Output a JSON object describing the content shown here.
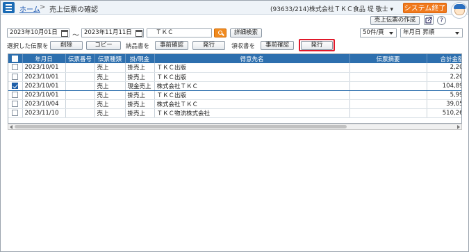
{
  "header": {
    "home_link": "ホーム",
    "separator": ">",
    "current_page": "売上伝票の確認",
    "user_info": "(93633/214)株式会社ＴＫＣ食品  堤  敬士 ▾",
    "exit_button": "システム終了"
  },
  "toolbar": {
    "create_button": "売上伝票の作成",
    "help_glyph": "?"
  },
  "search": {
    "date_from": "2023年10月01日",
    "range_sep": "〜",
    "date_to": "2023年11月11日",
    "keyword": "ＴＫＣ",
    "detail_button": "詳細検索",
    "per_page": "50件/頁",
    "sort": "年月日  昇順"
  },
  "actions": {
    "selected_label": "選択した伝票を",
    "delete_button": "削除",
    "copy_button": "コピー",
    "delivery_label": "納品書を",
    "delivery_preview": "事前確認",
    "delivery_issue": "発行",
    "receipt_label": "領収書を",
    "receipt_preview": "事前確認",
    "receipt_issue": "発行"
  },
  "table": {
    "headers": [
      "",
      "年月日",
      "伝票番号",
      "伝票種類",
      "掛/現金",
      "得意先名",
      "伝票摘要",
      "合計金額"
    ],
    "rows": [
      {
        "checked": false,
        "date": "2023/10/01",
        "no": "",
        "type": "売上",
        "pay": "掛売上",
        "customer": "ＴＫＣ出版",
        "memo": "",
        "total": "2,20"
      },
      {
        "checked": false,
        "date": "2023/10/01",
        "no": "",
        "type": "売上",
        "pay": "掛売上",
        "customer": "ＴＫＣ出版",
        "memo": "",
        "total": "2,20"
      },
      {
        "checked": true,
        "date": "2023/10/01",
        "no": "",
        "type": "売上",
        "pay": "現金売上",
        "customer": "株式会社ＴＫＣ",
        "memo": "",
        "total": "104,89"
      },
      {
        "checked": false,
        "date": "2023/10/01",
        "no": "",
        "type": "売上",
        "pay": "掛売上",
        "customer": "ＴＫＣ出版",
        "memo": "",
        "total": "5,99"
      },
      {
        "checked": false,
        "date": "2023/10/04",
        "no": "",
        "type": "売上",
        "pay": "掛売上",
        "customer": "株式会社ＴＫＣ",
        "memo": "",
        "total": "39,05"
      },
      {
        "checked": false,
        "date": "2023/11/10",
        "no": "",
        "type": "売上",
        "pay": "掛売上",
        "customer": "ＴＫＣ物流株式会社",
        "memo": "",
        "total": "510,26"
      }
    ]
  },
  "colors": {
    "header_blue": "#2d6fae",
    "accent_orange": "#f07a1e",
    "highlight_red": "#e0182a"
  }
}
